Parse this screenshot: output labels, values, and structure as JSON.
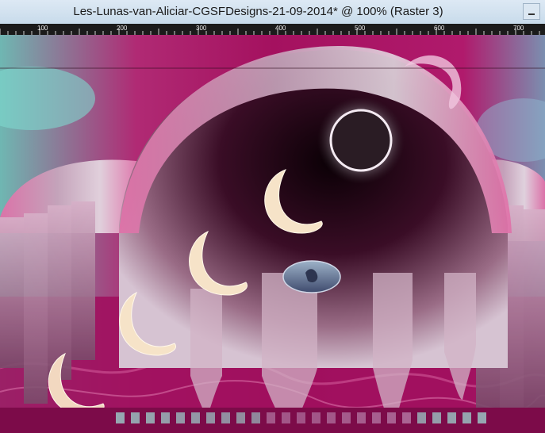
{
  "window": {
    "title": "Les-Lunas-van-Aliciar-CGSFDesigns-21-09-2014* @ 100% (Raster 3)"
  },
  "ruler": {
    "labels": [
      "100",
      "200",
      "300",
      "400",
      "500",
      "600",
      "700"
    ]
  },
  "icons": {
    "minimize": "minimize-icon"
  },
  "colors": {
    "magenta": "#a0105e",
    "pink": "#e070a8",
    "teal": "#7fd8cf",
    "ruler_bg": "#1b1b1b"
  }
}
